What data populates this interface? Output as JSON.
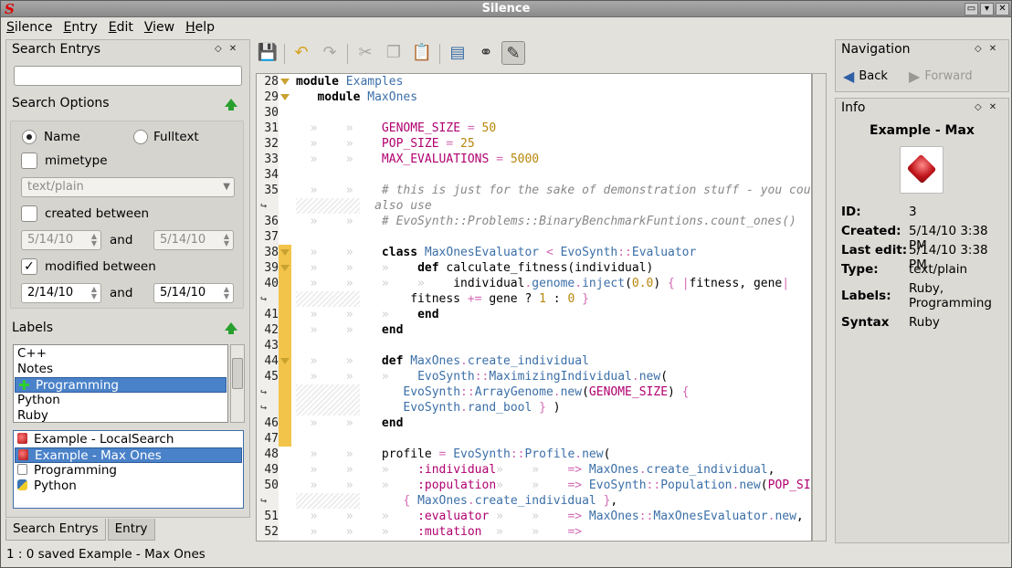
{
  "window": {
    "title": "Silence",
    "app_icon_glyph": "S",
    "buttons": [
      "▭",
      "▾",
      "✕"
    ]
  },
  "menu": [
    "Silence",
    "Entry",
    "Edit",
    "View",
    "Help"
  ],
  "search": {
    "heading": "Search Entrys",
    "value": "",
    "options_heading": "Search Options",
    "name_label": "Name",
    "fulltext_label": "Fulltext",
    "mimetype_label": "mimetype",
    "mimetype_value": "text/plain",
    "created_label": "created between",
    "created_from": "5/14/10",
    "created_to": "5/14/10",
    "and_label": "and",
    "modified_label": "modified between",
    "modified_from": "2/14/10",
    "modified_to": "5/14/10",
    "labels_heading": "Labels"
  },
  "labels": [
    "C++",
    "Notes",
    "Programming",
    "Python",
    "Ruby"
  ],
  "entries": [
    {
      "name": "Example - LocalSearch",
      "icon": "ruby"
    },
    {
      "name": "Example - Max Ones",
      "icon": "ruby"
    },
    {
      "name": "Programming",
      "icon": "txt"
    },
    {
      "name": "Python",
      "icon": "py"
    }
  ],
  "tabs": [
    "Search Entrys",
    "Entry"
  ],
  "status": "1 : 0  saved Example - Max Ones",
  "toolbar": [
    "save-icon",
    "undo-icon",
    "redo-icon",
    "cut-icon",
    "copy-icon",
    "paste-icon",
    "document-icon",
    "binoculars-icon",
    "edit-icon"
  ],
  "code_lines": [
    {
      "n": "28",
      "fold": true,
      "html": "<span class=\"k\">module</span> <span class=\"c\">Examples</span>"
    },
    {
      "n": "29",
      "fold": true,
      "html": "   <span class=\"k\">module</span> <span class=\"c\">MaxOnes</span>"
    },
    {
      "n": "30",
      "html": ""
    },
    {
      "n": "31",
      "html": "<span class=\"tab-ind\">  »    »    </span><span class=\"const\">GENOME_SIZE</span> <span class=\"op\">=</span> <span class=\"num\">50</span>"
    },
    {
      "n": "32",
      "html": "<span class=\"tab-ind\">  »    »    </span><span class=\"const\">POP_SIZE</span> <span class=\"op\">=</span> <span class=\"num\">25</span>"
    },
    {
      "n": "33",
      "html": "<span class=\"tab-ind\">  »    »    </span><span class=\"const\">MAX_EVALUATIONS</span> <span class=\"op\">=</span> <span class=\"num\">5000</span>"
    },
    {
      "n": "34",
      "html": ""
    },
    {
      "n": "35",
      "html": "<span class=\"tab-ind\">  »    »    </span><span class=\"cm\"># this is just for the sake of demonstration stuff - you could</span>"
    },
    {
      "n": "",
      "wrap": true,
      "html": "<span class=\"cm\">           also use</span>"
    },
    {
      "n": "36",
      "html": "<span class=\"tab-ind\">  »    »    </span><span class=\"cm\"># EvoSynth::Problems::BinaryBenchmarkFuntions.count_ones()</span>"
    },
    {
      "n": "37",
      "html": ""
    },
    {
      "n": "38",
      "fold": true,
      "html": "<span class=\"tab-ind\">  »    »    </span><span class=\"k\">class</span> <span class=\"c\">MaxOnesEvaluator</span> <span class=\"op\">&lt;</span> <span class=\"c\">EvoSynth</span><span class=\"op\">::</span><span class=\"c\">Evaluator</span>"
    },
    {
      "n": "39",
      "fold": true,
      "html": "<span class=\"tab-ind\">  »    »    »    </span><span class=\"k\">def</span> calculate_fitness(individual)"
    },
    {
      "n": "40",
      "html": "<span class=\"tab-ind\">  »    »    »    »    </span>individual<span class=\"op\">.</span><span class=\"c\">genome</span><span class=\"op\">.</span><span class=\"c\">inject</span>(<span class=\"num\">0.0</span>) <span class=\"op\">{</span> <span class=\"op\">|</span>fitness, gene<span class=\"op\">|</span>"
    },
    {
      "n": "",
      "wrap": true,
      "html": "                fitness <span class=\"op\">+=</span> gene ? <span class=\"num\">1</span> : <span class=\"num\">0</span> <span class=\"op\">}</span>"
    },
    {
      "n": "41",
      "html": "<span class=\"tab-ind\">  »    »    »    </span><span class=\"k\">end</span>"
    },
    {
      "n": "42",
      "html": "<span class=\"tab-ind\">  »    »    </span><span class=\"k\">end</span>"
    },
    {
      "n": "43",
      "html": ""
    },
    {
      "n": "44",
      "fold": true,
      "html": "<span class=\"tab-ind\">  »    »    </span><span class=\"k\">def</span> <span class=\"c\">MaxOnes</span><span class=\"op\">.</span><span class=\"c\">create_individual</span>"
    },
    {
      "n": "45",
      "html": "<span class=\"tab-ind\">  »    »    »    </span><span class=\"c\">EvoSynth</span><span class=\"op\">::</span><span class=\"c\">MaximizingIndividual</span><span class=\"op\">.</span><span class=\"c\">new</span>("
    },
    {
      "n": "",
      "wrap": true,
      "html": "               <span class=\"c\">EvoSynth</span><span class=\"op\">::</span><span class=\"c\">ArrayGenome</span><span class=\"op\">.</span><span class=\"c\">new</span>(<span class=\"const\">GENOME_SIZE</span>) <span class=\"op\">{</span>"
    },
    {
      "n": "",
      "wrap": true,
      "html": "               <span class=\"c\">EvoSynth</span><span class=\"op\">.</span><span class=\"c\">rand_bool</span> <span class=\"op\">}</span> )"
    },
    {
      "n": "46",
      "html": "<span class=\"tab-ind\">  »    »    </span><span class=\"k\">end</span>"
    },
    {
      "n": "47",
      "html": ""
    },
    {
      "n": "48",
      "html": "<span class=\"tab-ind\">  »    »    </span>profile <span class=\"op\">=</span> <span class=\"c\">EvoSynth</span><span class=\"op\">::</span><span class=\"c\">Profile</span><span class=\"op\">.</span><span class=\"c\">new</span>("
    },
    {
      "n": "49",
      "html": "<span class=\"tab-ind\">  »    »    »    </span><span class=\"sym\">:individual</span><span class=\"tab-ind\">»    »    </span><span class=\"op\">=&gt;</span> <span class=\"c\">MaxOnes</span><span class=\"op\">.</span><span class=\"c\">create_individual</span>,"
    },
    {
      "n": "50",
      "html": "<span class=\"tab-ind\">  »    »    »    </span><span class=\"sym\">:population</span><span class=\"tab-ind\">»    »    </span><span class=\"op\">=&gt;</span> <span class=\"c\">EvoSynth</span><span class=\"op\">::</span><span class=\"c\">Population</span><span class=\"op\">.</span><span class=\"c\">new</span>(<span class=\"const\">POP_SIZE</span>)"
    },
    {
      "n": "",
      "wrap": true,
      "html": "               <span class=\"op\">{</span> <span class=\"c\">MaxOnes</span><span class=\"op\">.</span><span class=\"c\">create_individual</span> <span class=\"op\">}</span>,"
    },
    {
      "n": "51",
      "html": "<span class=\"tab-ind\">  »    »    »    </span><span class=\"sym\">:evaluator</span><span class=\"tab-ind\"> »    »    </span><span class=\"op\">=&gt;</span> <span class=\"c\">MaxOnes</span><span class=\"op\">::</span><span class=\"c\">MaxOnesEvaluator</span><span class=\"op\">.</span><span class=\"c\">new</span>,"
    },
    {
      "n": "52",
      "html": "<span class=\"tab-ind\">  »    »    »    </span><span class=\"sym\">:mutation</span><span class=\"tab-ind\">  »    »    </span><span class=\"op\">=&gt;</span>"
    }
  ],
  "navigation": {
    "heading": "Navigation",
    "back": "Back",
    "forward": "Forward"
  },
  "info": {
    "heading": "Info",
    "title": "Example - Max",
    "rows": [
      {
        "key": "ID:",
        "value": "3"
      },
      {
        "key": "Created:",
        "value": "5/14/10 3:38 PM"
      },
      {
        "key": "Last edit:",
        "value": "5/14/10 3:38 PM"
      },
      {
        "key": "Type:",
        "value": "text/plain"
      },
      {
        "key": "Labels:",
        "value": "Ruby, Programming"
      },
      {
        "key": "Syntax",
        "value": "Ruby"
      }
    ]
  },
  "colors": {
    "selection": "#4a82c9",
    "fold_marker": "#f3c44a",
    "title_bar": "#8a8a8a"
  }
}
